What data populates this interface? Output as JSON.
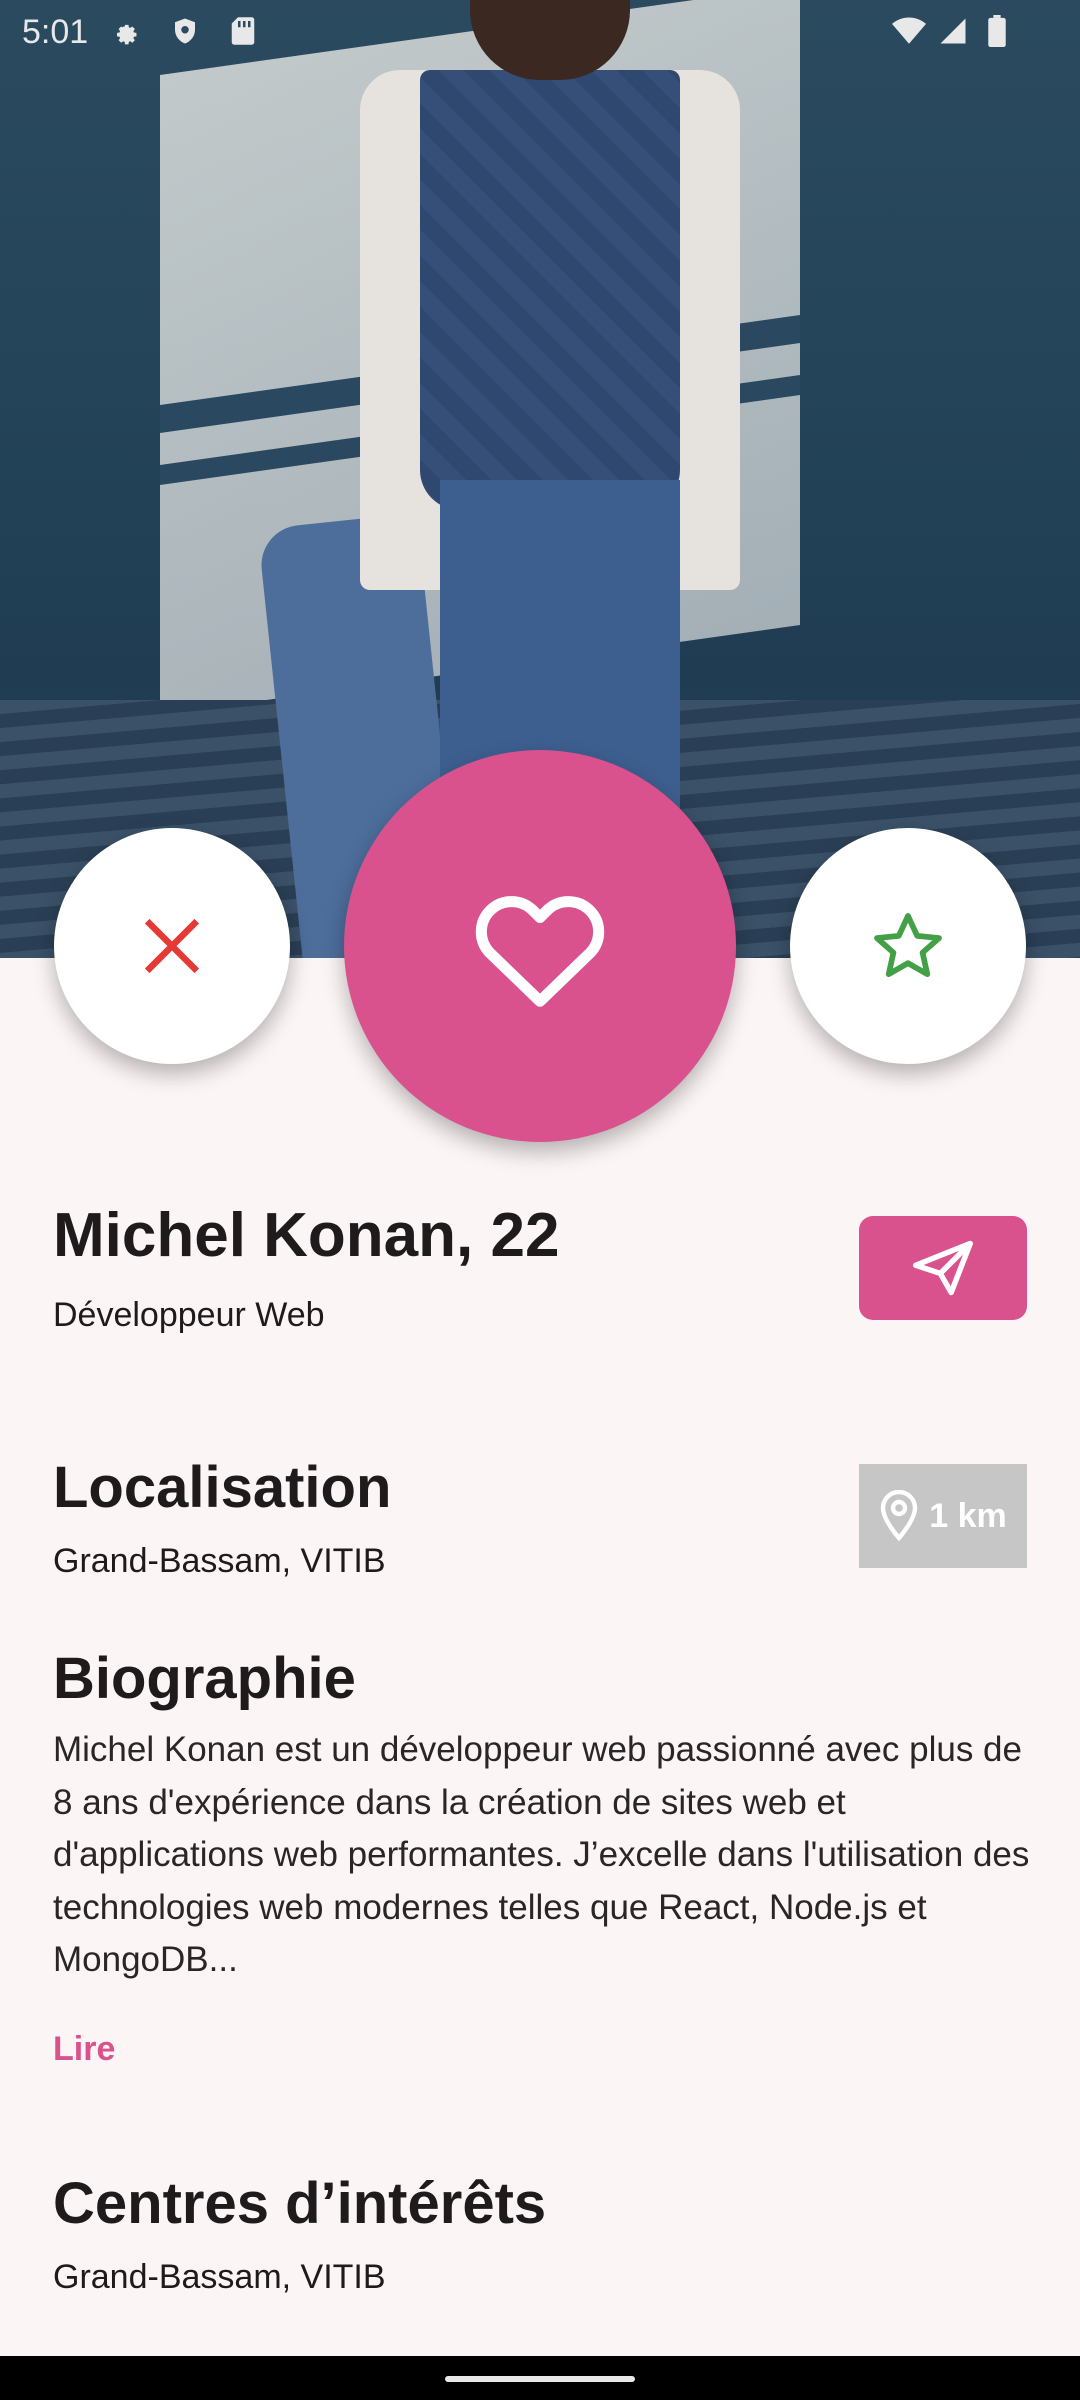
{
  "status_bar": {
    "time": "5:01"
  },
  "profile": {
    "name": "Michel Konan, 22",
    "job": "Développeur Web"
  },
  "location": {
    "title": "Localisation",
    "place": "Grand-Bassam, VITIB",
    "distance": "1 km"
  },
  "biography": {
    "title": "Biographie",
    "text": "Michel Konan est un développeur web passionné avec plus de 8 ans d'expérience dans la création de sites web et d'applications web performantes. J’excelle dans l'utilisation des technologies web modernes telles que React, Node.js et MongoDB...",
    "read_more": "Lire"
  },
  "interests": {
    "title": "Centres d’intérêts",
    "value": "Grand-Bassam, VITIB"
  },
  "colors": {
    "accent": "#d9528d",
    "pass": "#e53935",
    "super": "#43a047",
    "distance_bg": "#c6c6c6"
  },
  "icons": [
    "settings-icon",
    "shield-icon",
    "sd-card-icon",
    "wifi-icon",
    "signal-icon",
    "battery-icon",
    "close-icon",
    "heart-icon",
    "star-icon",
    "send-icon",
    "location-pin-icon"
  ]
}
